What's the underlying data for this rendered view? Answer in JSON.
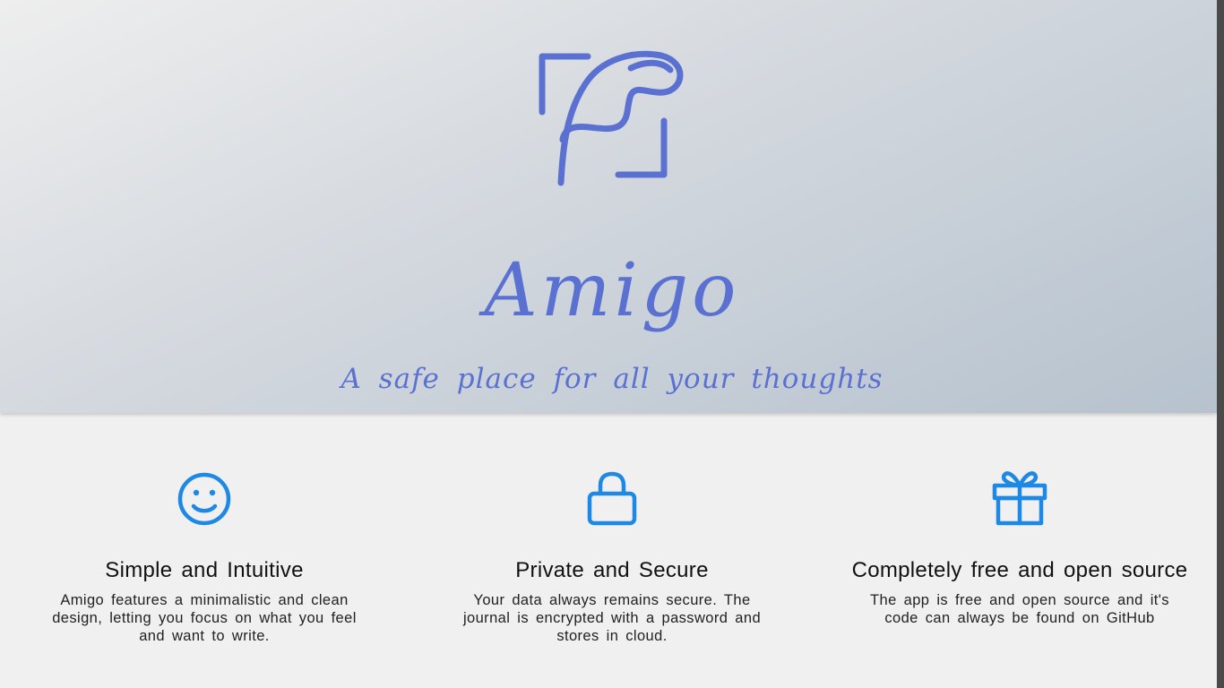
{
  "hero": {
    "title": "Amigo",
    "tagline": "A safe place for all your thoughts",
    "logo_icon": "amigo-logo-icon"
  },
  "colors": {
    "brand": "#5b71d2",
    "feature_icon": "#1e88e5",
    "hero_gradient_start": "#eeeeee",
    "hero_gradient_end": "#b6c2ce",
    "background": "#f0f0f0"
  },
  "features": [
    {
      "icon": "smiley-face-icon",
      "title": "Simple and Intuitive",
      "description": "Amigo features a minimalistic and clean design, letting you focus on what you feel and want to write."
    },
    {
      "icon": "lock-icon",
      "title": "Private and Secure",
      "description": "Your data always remains secure. The journal is encrypted with a password and stores in cloud."
    },
    {
      "icon": "gift-icon",
      "title": "Completely free and open source",
      "description": "The app is free and open source and it's code can always be found on GitHub"
    }
  ]
}
